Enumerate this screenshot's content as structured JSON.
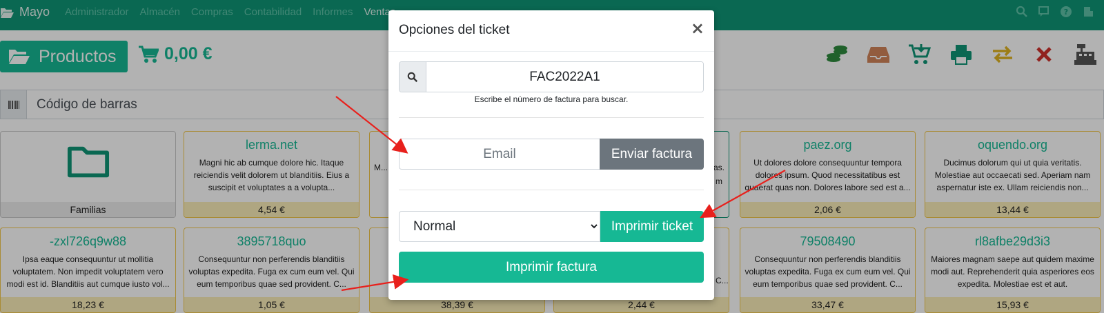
{
  "navbar": {
    "brand": "Mayo",
    "menu": [
      "Administrador",
      "Almacén",
      "Compras",
      "Contabilidad",
      "Informes",
      "Ventas"
    ],
    "active_menu": "Ventas",
    "right_icons": [
      "search-icon",
      "chat-icon",
      "help-icon",
      "user-icon"
    ]
  },
  "toolbar": {
    "productos_label": "Productos",
    "cart_total": "0,00 €",
    "tools": [
      {
        "name": "coins-icon",
        "color": "#2e8b3e"
      },
      {
        "name": "inbox-icon",
        "color": "#d2845a"
      },
      {
        "name": "cart-download-icon",
        "color": "#0f9676"
      },
      {
        "name": "print-icon",
        "color": "#0f9676"
      },
      {
        "name": "exchange-icon",
        "color": "#e0b320"
      },
      {
        "name": "close-icon",
        "color": "#d0312d"
      },
      {
        "name": "cash-register-icon",
        "color": "#555555"
      }
    ]
  },
  "barcode": {
    "placeholder": "Código de barras"
  },
  "families_label": "Familias",
  "products_row1": [
    {
      "title": "lerma.net",
      "desc": "Magni hic ab cumque dolore hic. Itaque reiciendis velit dolorem ut blanditiis. Eius a suscipit et voluptates a a volupta...",
      "price": "4,54 €"
    },
    {
      "title": "paez.org",
      "desc": "Ut dolores dolore consequuntur tempora dolores ipsum. Quod necessitatibus est quaerat quas non. Dolores labore sed est a...",
      "price": "2,06 €"
    },
    {
      "title": "oquendo.org",
      "desc": "Ducimus dolorum qui ut quia veritatis. Molestiae aut occaecati sed. Aperiam nam aspernatur iste ex. Ullam reiciendis non...",
      "price": "13,44 €"
    }
  ],
  "products_row2": [
    {
      "title": "-zxl726q9w88",
      "desc": "Ipsa eaque consequuntur ut mollitia voluptatem. Non impedit voluptatem vero modi est id. Blanditiis aut cumque iusto vol...",
      "price": "18,23 €"
    },
    {
      "title": "3895718quo",
      "desc": "Consequuntur non perferendis blanditiis voluptas expedita. Fuga ex cum eum vel. Qui eum temporibus quae sed provident. C...",
      "price": "1,05 €"
    },
    {
      "title": "",
      "desc": "",
      "price": "38,39 €"
    },
    {
      "title": "",
      "desc": "",
      "price": "2,44 €"
    },
    {
      "title": "79508490",
      "desc": "Consequuntur non perferendis blanditiis voluptas expedita. Fuga ex cum eum vel. Qui eum temporibus quae sed provident. C...",
      "price": "33,47 €"
    },
    {
      "title": "rl8afbe29d3i3",
      "desc": "Maiores magnam saepe aut quidem maxime modi aut. Reprehenderit quia asperiores eos expedita. Molestiae est et aut.",
      "price": "15,93 €"
    }
  ],
  "hidden_fragments": {
    "row1_col3_desc": "M...",
    "row1_col4_desc_a": "as.",
    "row1_col4_desc_b": "m",
    "row2_col3_desc": "C..."
  },
  "modal": {
    "title": "Opciones del ticket",
    "close_label": "×",
    "search_value": "FAC2022A1",
    "search_help": "Escribe el número de factura para buscar.",
    "email_placeholder": "Email",
    "enviar_label": "Enviar factura",
    "format_options": [
      "Normal"
    ],
    "format_selected": "Normal",
    "print_ticket_label": "Imprimir ticket",
    "print_invoice_label": "Imprimir factura"
  },
  "colors": {
    "brand": "#0f9676",
    "accent": "#16b894",
    "secondary": "#6c757d",
    "arrow": "#e8201c"
  }
}
